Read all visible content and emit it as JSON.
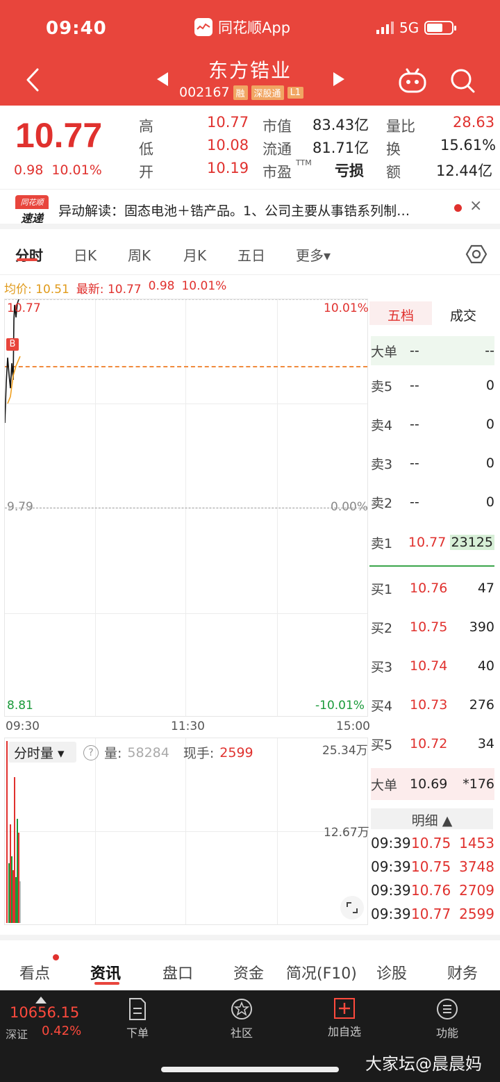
{
  "status_bar": {
    "time": "09:40",
    "app_name": "同花顺App",
    "network": "5G"
  },
  "stock": {
    "name": "东方锆业",
    "code": "002167",
    "tags": [
      "融",
      "深股通",
      "L1"
    ]
  },
  "quote": {
    "price": "10.77",
    "change": "0.98",
    "change_pct": "10.01%",
    "high_label": "高",
    "high": "10.77",
    "low_label": "低",
    "low": "10.08",
    "open_label": "开",
    "open": "10.19",
    "mcap_label": "市值",
    "mcap": "83.43亿",
    "float_label": "流通",
    "float": "81.71亿",
    "pe_label": "市盈",
    "pe_sup": "TTM",
    "pe": "亏损",
    "vr_label": "量比",
    "vr": "28.63",
    "turnover_label": "换",
    "turnover": "15.61%",
    "amount_label": "额",
    "amount": "12.44亿"
  },
  "notice": {
    "logo_top": "同花顺",
    "logo_bottom": "速递",
    "text": "异动解读：固态电池＋锆产品。1、公司主要从事锆系列制…",
    "close": "×"
  },
  "tabs": [
    "分时",
    "日K",
    "周K",
    "月K",
    "五日",
    "更多▾"
  ],
  "avg_row": {
    "avg_label": "均价:",
    "avg": "10.51",
    "latest_label": "最新:",
    "latest": "10.77",
    "chg": "0.98",
    "pct": "10.01%"
  },
  "chart": {
    "y_top": "10.77",
    "y_mid": "9.79",
    "y_bot": "8.81",
    "pct_top": "10.01%",
    "pct_mid": "0.00%",
    "pct_bot": "-10.01%",
    "x_labels": [
      "09:30",
      "11:30",
      "15:00"
    ],
    "marker": "B"
  },
  "chart_data": {
    "type": "line",
    "x": [
      "09:30",
      "11:30",
      "15:00"
    ],
    "series": [],
    "ylim": [
      8.81,
      10.77
    ],
    "avg_price": 10.51
  },
  "volume": {
    "selector": "分时量 ▾",
    "help": "?",
    "vol_label": "量:",
    "vol": "58284",
    "hand_label": "现手:",
    "hand": "2599",
    "top": "25.34万",
    "mid": "12.67万"
  },
  "panel": {
    "tabs": [
      "五档",
      "成交"
    ],
    "big_top": {
      "label": "大单",
      "price": "--",
      "qty": "--"
    },
    "sells": [
      {
        "label": "卖5",
        "price": "--",
        "qty": "0"
      },
      {
        "label": "卖4",
        "price": "--",
        "qty": "0"
      },
      {
        "label": "卖3",
        "price": "--",
        "qty": "0"
      },
      {
        "label": "卖2",
        "price": "--",
        "qty": "0"
      },
      {
        "label": "卖1",
        "price": "10.77",
        "qty": "23125"
      }
    ],
    "buys": [
      {
        "label": "买1",
        "price": "10.76",
        "qty": "47"
      },
      {
        "label": "买2",
        "price": "10.75",
        "qty": "390"
      },
      {
        "label": "买3",
        "price": "10.74",
        "qty": "40"
      },
      {
        "label": "买4",
        "price": "10.73",
        "qty": "276"
      },
      {
        "label": "买5",
        "price": "10.72",
        "qty": "34"
      }
    ],
    "big_bottom": {
      "label": "大单",
      "price": "10.69",
      "qty": "*176"
    },
    "detail_label": "明细 ▲",
    "trades": [
      {
        "time": "09:39",
        "price": "10.75",
        "vol": "1453"
      },
      {
        "time": "09:39",
        "price": "10.75",
        "vol": "3748"
      },
      {
        "time": "09:39",
        "price": "10.76",
        "vol": "2709"
      },
      {
        "time": "09:39",
        "price": "10.77",
        "vol": "2599"
      }
    ]
  },
  "bottom_tabs": [
    "看点",
    "资讯",
    "盘口",
    "资金",
    "简况(F10)",
    "诊股",
    "财务"
  ],
  "bottom_bar": {
    "index_value": "10656.15",
    "index_name": "深证",
    "index_pct": "0.42%",
    "items": [
      "下单",
      "社区",
      "加自选",
      "功能"
    ],
    "watermark": "大家坛@晨晨妈"
  }
}
